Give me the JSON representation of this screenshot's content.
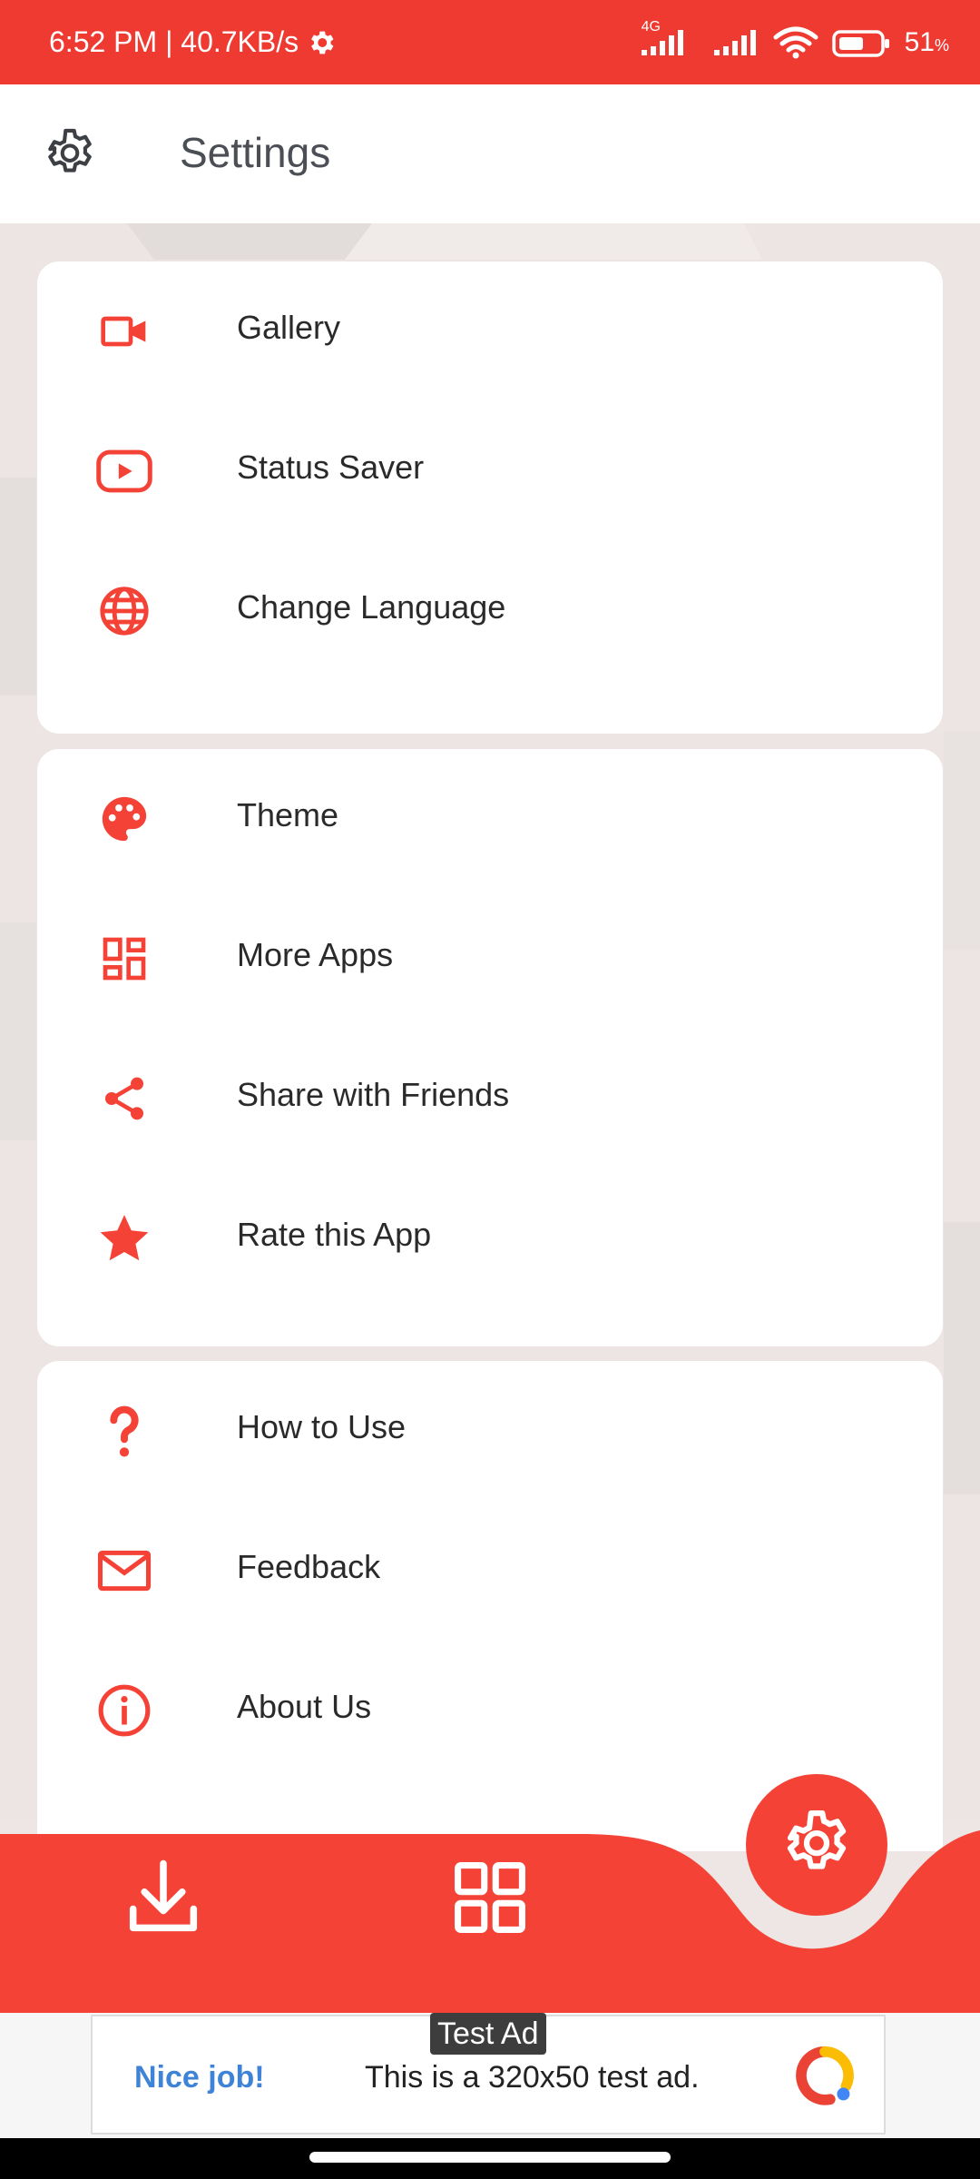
{
  "status_bar": {
    "time_speed": "6:52 PM | 40.7KB/s",
    "network_type": "4G",
    "battery": "51",
    "battery_unit": "%"
  },
  "app_bar": {
    "title": "Settings",
    "icon": "gear-icon"
  },
  "cards": [
    {
      "items": [
        {
          "label": "Gallery",
          "icon": "video-camera-icon"
        },
        {
          "label": "Status Saver",
          "icon": "youtube-play-icon"
        },
        {
          "label": "Change Language",
          "icon": "globe-icon"
        }
      ]
    },
    {
      "items": [
        {
          "label": "Theme",
          "icon": "palette-icon"
        },
        {
          "label": "More Apps",
          "icon": "dashboard-icon"
        },
        {
          "label": "Share with Friends",
          "icon": "share-icon"
        },
        {
          "label": "Rate this App",
          "icon": "star-icon"
        }
      ]
    },
    {
      "items": [
        {
          "label": "How to Use",
          "icon": "question-icon"
        },
        {
          "label": "Feedback",
          "icon": "mail-icon"
        },
        {
          "label": "About Us",
          "icon": "info-icon"
        }
      ]
    }
  ],
  "bottom_nav": {
    "items": [
      {
        "icon": "download-icon"
      },
      {
        "icon": "grid-icon"
      },
      {
        "icon": "settings-gear-icon",
        "active": true
      }
    ]
  },
  "ad": {
    "tag": "Test Ad",
    "nice": "Nice job!",
    "text": "This is a 320x50 test ad."
  },
  "colors": {
    "accent": "#F44336",
    "statusbar": "#EE3A31",
    "text": "#2A2A2A",
    "title": "#4B4F55"
  }
}
